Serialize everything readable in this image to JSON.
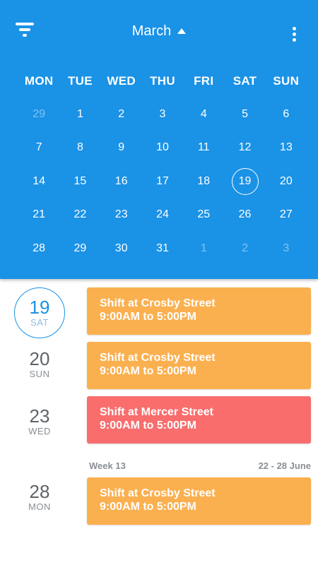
{
  "header": {
    "month": "March",
    "filter_icon": "filter-icon",
    "more_icon": "more-vertical-icon",
    "caret_icon": "caret-up-icon",
    "background_color": "#1a92e6"
  },
  "calendar": {
    "weekdays": [
      "MON",
      "TUE",
      "WED",
      "THU",
      "FRI",
      "SAT",
      "SUN"
    ],
    "weeks": [
      [
        "29",
        "1",
        "2",
        "3",
        "4",
        "5",
        "6"
      ],
      [
        "7",
        "8",
        "9",
        "10",
        "11",
        "12",
        "13"
      ],
      [
        "14",
        "15",
        "16",
        "17",
        "18",
        "19",
        "20"
      ],
      [
        "21",
        "22",
        "23",
        "24",
        "25",
        "26",
        "27"
      ],
      [
        "28",
        "29",
        "30",
        "31",
        "1",
        "2",
        "3"
      ]
    ],
    "selected_day": "19"
  },
  "agenda": {
    "days": [
      {
        "num": "19",
        "name": "SAT",
        "shift_title": "Shift at Crosby Street",
        "shift_time": "9:00AM to 5:00PM",
        "color": "#fbb04f"
      },
      {
        "num": "20",
        "name": "SUN",
        "shift_title": "Shift at Crosby Street",
        "shift_time": "9:00AM to 5:00PM",
        "color": "#fbb04f"
      },
      {
        "num": "23",
        "name": "WED",
        "shift_title": "Shift at Mercer Street",
        "shift_time": "9:00AM to 5:00PM",
        "color": "#f96d6d"
      },
      {
        "num": "28",
        "name": "MON",
        "shift_title": "Shift at Crosby Street",
        "shift_time": "9:00AM to 5:00PM",
        "color": "#fbb04f"
      }
    ],
    "week_separator": {
      "label": "Week 13",
      "range": "22 - 28 June"
    }
  }
}
